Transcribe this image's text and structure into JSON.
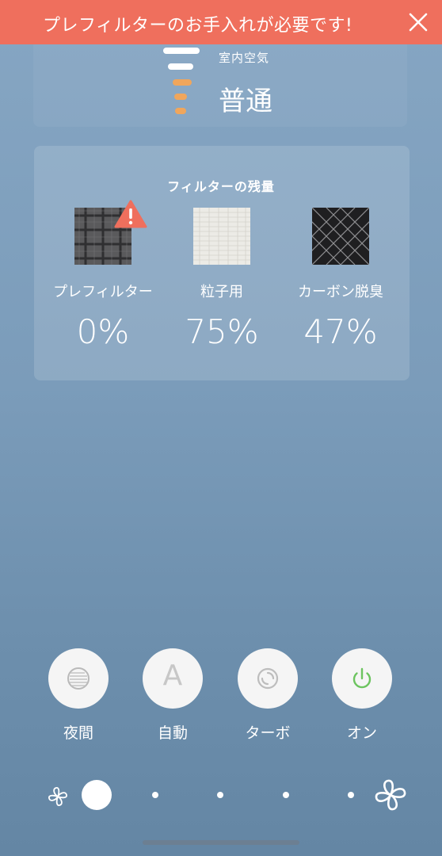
{
  "banner": {
    "text": "プレフィルターのお手入れが必要です!",
    "close_icon": "close-icon",
    "color": "#ef6f5d"
  },
  "air_quality": {
    "caption": "室内空気",
    "level": "普通",
    "bars_total": 5,
    "bars_white": 2,
    "bar_colors": {
      "good": "#ffffff",
      "level": "#f0a65c"
    }
  },
  "filters": {
    "title": "フィルターの残量",
    "items": [
      {
        "name": "プレフィルター",
        "percent": "0%",
        "icon": "prefilter-image",
        "warning": true
      },
      {
        "name": "粒子用",
        "percent": "75%",
        "icon": "particle-filter-image",
        "warning": false
      },
      {
        "name": "カーボン脱臭",
        "percent": "47%",
        "icon": "carbon-filter-image",
        "warning": false
      }
    ]
  },
  "modes": [
    {
      "label": "夜間",
      "icon": "night-mode-icon"
    },
    {
      "label": "自動",
      "icon": "auto-mode-icon",
      "letter": "A"
    },
    {
      "label": "ターボ",
      "icon": "turbo-mode-icon"
    },
    {
      "label": "オン",
      "icon": "power-icon",
      "color": "#6cc45f"
    }
  ],
  "fan_speed": {
    "level": 1,
    "max_level": 5,
    "min_icon": "fan-low-icon",
    "max_icon": "fan-high-icon"
  }
}
